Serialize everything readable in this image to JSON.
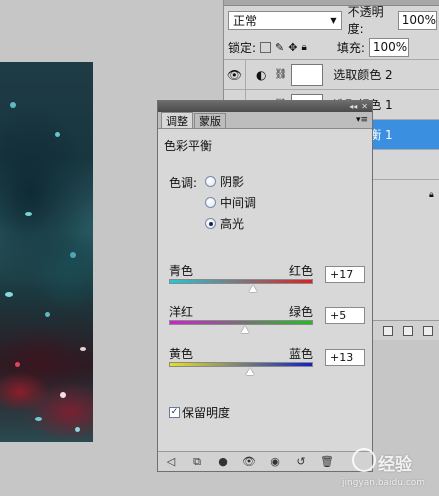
{
  "layers_panel": {
    "blend_mode": "正常",
    "opacity_label": "不透明度:",
    "opacity_value": "100%",
    "lock_label": "锁定:",
    "fill_label": "填充:",
    "fill_value": "100%",
    "layers": [
      {
        "name": "选取颜色 2",
        "selected": false
      },
      {
        "name": "选取颜色 1",
        "selected": false
      },
      {
        "name": "色彩平衡 1",
        "selected": true
      }
    ]
  },
  "adjustments": {
    "tabs": [
      "调整",
      "蒙版"
    ],
    "active_tab": "调整",
    "title": "色彩平衡",
    "tone_label": "色调:",
    "tones": [
      {
        "label": "阴影",
        "checked": false
      },
      {
        "label": "中间调",
        "checked": false
      },
      {
        "label": "高光",
        "checked": true
      }
    ],
    "sliders": [
      {
        "left": "青色",
        "right": "红色",
        "value": "+17",
        "level": 17,
        "gradient": [
          "#20c8d8",
          "#e02020"
        ]
      },
      {
        "left": "洋红",
        "right": "绿色",
        "value": "+5",
        "level": 5,
        "gradient": [
          "#d020d0",
          "#20c020"
        ]
      },
      {
        "left": "黄色",
        "right": "蓝色",
        "value": "+13",
        "level": 13,
        "gradient": [
          "#e8e020",
          "#1020d0"
        ]
      }
    ],
    "preserve_label": "保留明度",
    "preserve_checked": true
  },
  "watermark": {
    "brand": "经验",
    "url": "jingyan.baidu.com"
  }
}
